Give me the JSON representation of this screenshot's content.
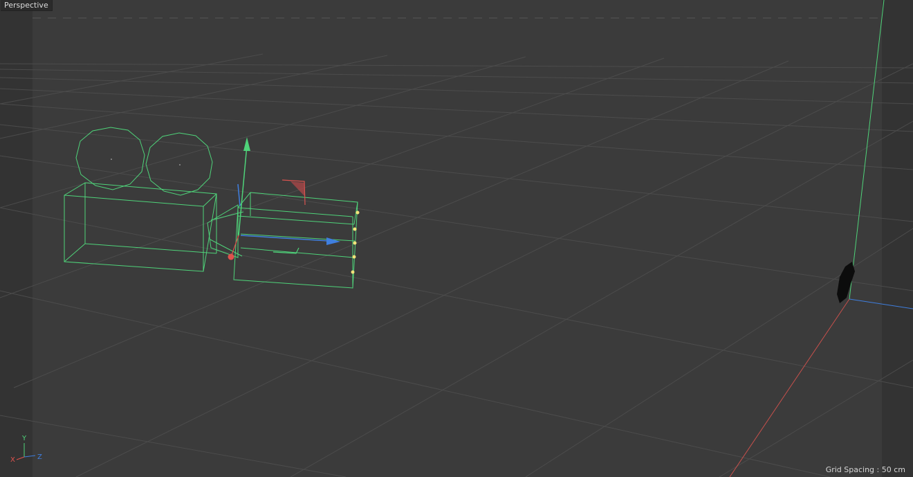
{
  "viewport": {
    "view_name": "Perspective",
    "grid_spacing_label": "Grid Spacing : 50 cm"
  },
  "axis_gizmo": {
    "y": "Y",
    "x": "X",
    "z": "Z"
  },
  "colors": {
    "background": "#3b3b3b",
    "safe_frame": "#323232",
    "grid_line": "#4a4a4a",
    "wireframe_selected": "#4fd47a",
    "axis_x": "#e0524d",
    "axis_y": "#4fd47a",
    "axis_z": "#3f7fe0",
    "handle_point": "#f2e27a"
  },
  "icons": [
    "camera-object-wireframe",
    "move-gizmo",
    "world-origin-marker"
  ]
}
